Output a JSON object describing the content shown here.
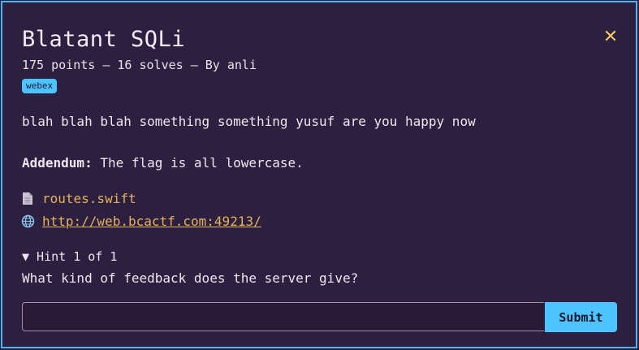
{
  "challenge": {
    "title": "Blatant SQLi",
    "meta": "175 points · 16 solves · By anli",
    "meta_display": "175 points – 16 solves – By anli",
    "tag": "webex",
    "description": "blah blah blah something something yusuf are you happy now",
    "addendum_label": "Addendum:",
    "addendum_text": " The flag is all lowercase.",
    "files": [
      {
        "name": "routes.swift",
        "icon": "file-icon"
      }
    ],
    "links": [
      {
        "url": "http://web.bcactf.com:49213/",
        "icon": "globe-icon"
      }
    ],
    "hint": {
      "header": "▼ Hint 1 of 1",
      "text": "What kind of feedback does the server give?"
    }
  },
  "form": {
    "input_value": "",
    "input_placeholder": "",
    "submit_label": "Submit"
  },
  "colors": {
    "accent": "#4dc4ff",
    "link": "#e4b35a",
    "close": "#f2c86a",
    "background": "#2d1f3f"
  }
}
